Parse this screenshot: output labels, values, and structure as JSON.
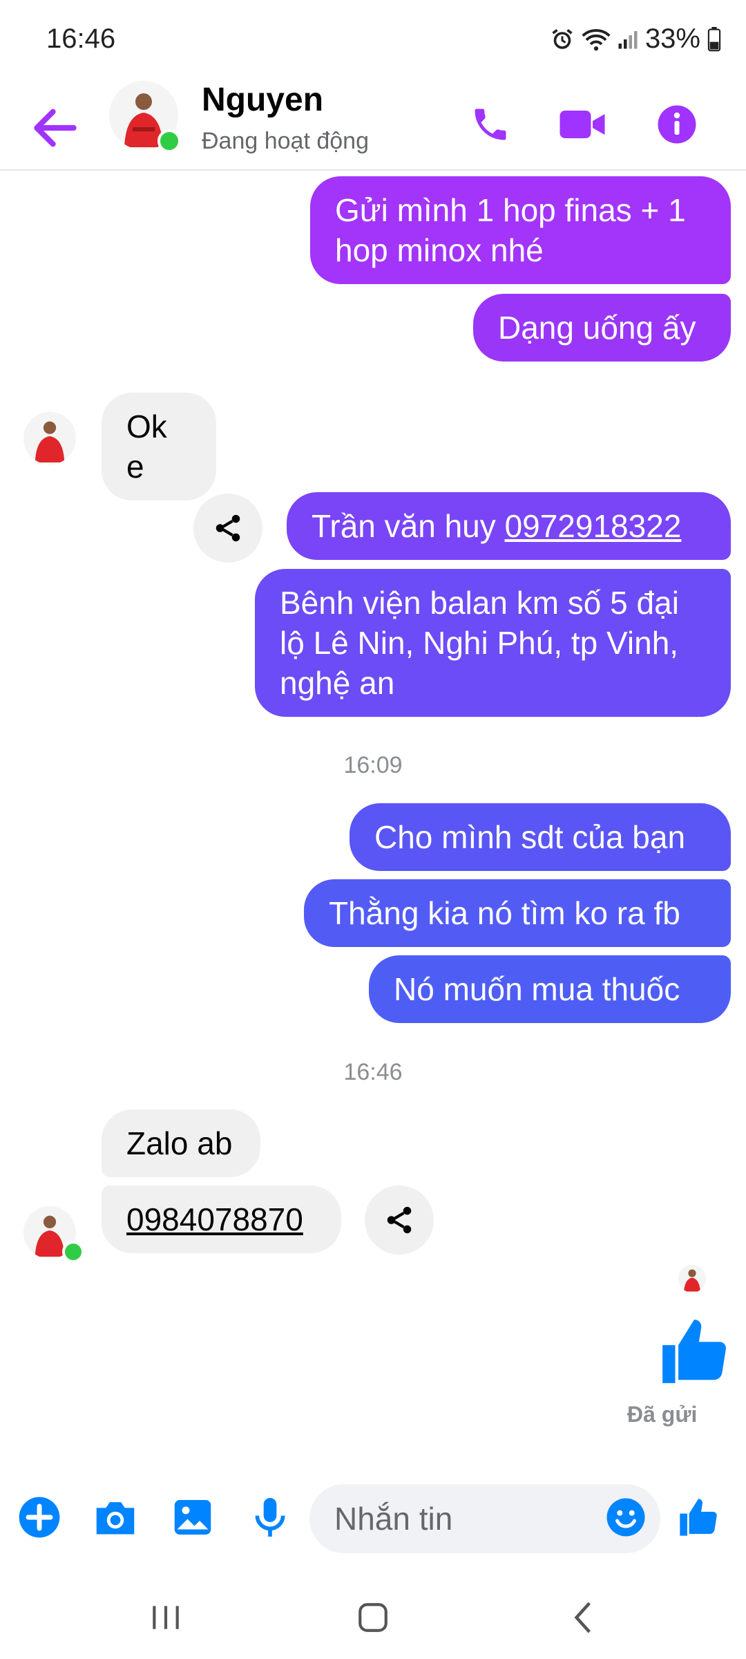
{
  "status_bar": {
    "time": "16:46",
    "battery": "33%"
  },
  "header": {
    "contact_name": "Nguyen",
    "contact_status": "Đang hoạt động"
  },
  "messages": {
    "m1": "Gửi mình 1 hop finas + 1 hop minox nhé",
    "m2": "Dạng uống ấy",
    "m3": "Ok e",
    "m4_prefix": "Trần văn huy ",
    "m4_phone": "0972918322",
    "m5": "Bênh viện balan km số 5 đại lộ Lê Nin, Nghi Phú, tp Vinh, nghệ an",
    "ts1": "16:09",
    "m6": "Cho mình sdt của bạn",
    "m7": "Thằng kia nó tìm ko ra fb",
    "m8": "Nó muốn mua thuốc",
    "ts2": "16:46",
    "m9": "Zalo ab",
    "m10_phone": "0984078870",
    "sent_label": "Đã gửi"
  },
  "composer": {
    "placeholder": "Nhắn tin"
  },
  "colors": {
    "accent": "#a033ff",
    "blue": "#0084ff",
    "bubble_top": "#a334fa",
    "bubble_mid": "#6b4cf6",
    "bubble_bottom": "#4e5ef5",
    "incoming": "#f0f0f0"
  }
}
